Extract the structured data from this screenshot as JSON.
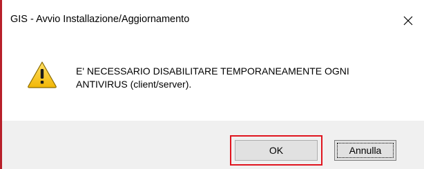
{
  "window": {
    "title": "GIS - Avvio Installazione/Aggiornamento",
    "close_icon": "close-icon",
    "accent_color": "#b8202a"
  },
  "message": {
    "icon": "warning-icon",
    "line1": "E' NECESSARIO DISABILITARE TEMPORANEAMENTE OGNI",
    "line2": "ANTIVIRUS (client/server)."
  },
  "buttons": {
    "ok_label": "OK",
    "cancel_label": "Annulla",
    "highlight_color": "#e0141e"
  }
}
